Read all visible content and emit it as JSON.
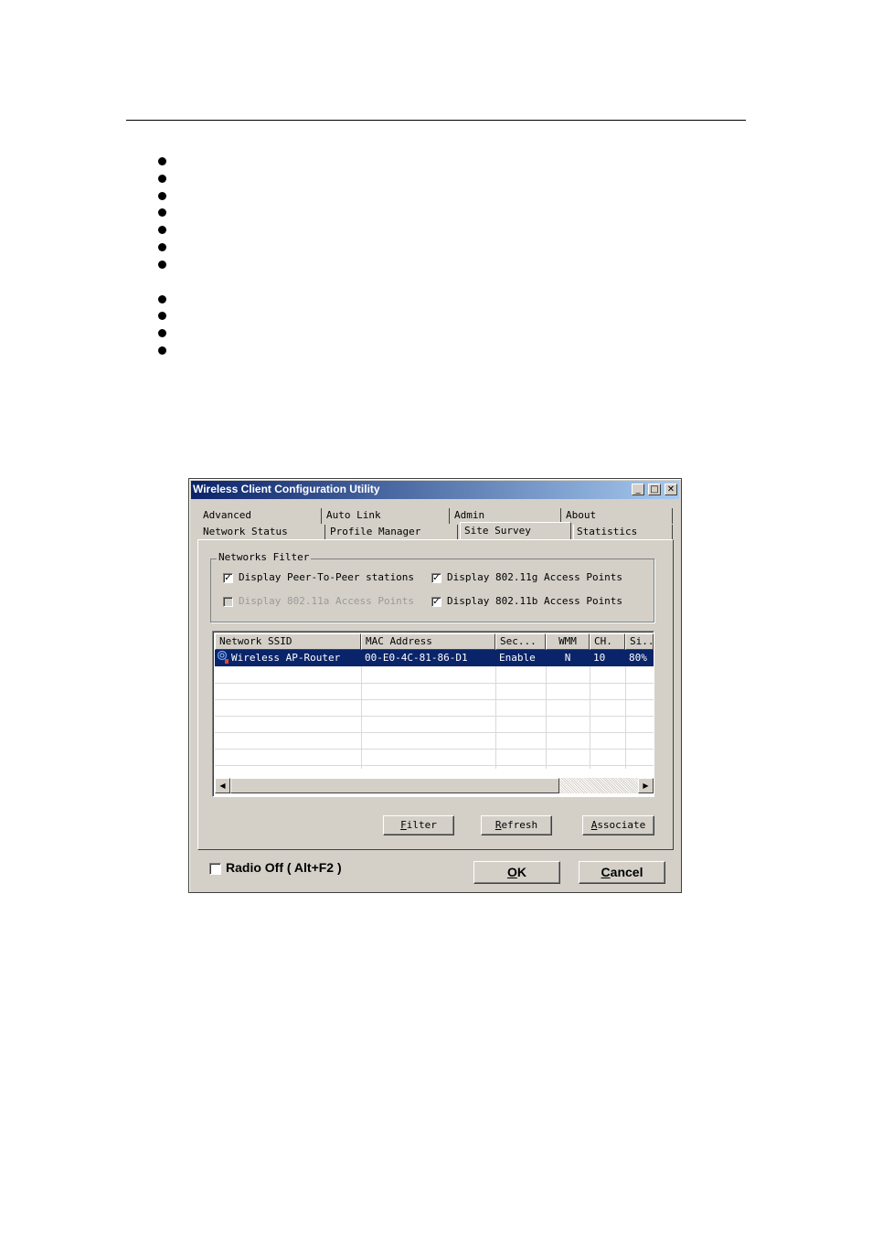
{
  "document": {
    "bullet_count": 11
  },
  "window": {
    "title": "Wireless Client Configuration Utility",
    "minimize_glyph": "_",
    "maximize_glyph": "□",
    "close_glyph": "✕",
    "tabs_row1": [
      "Advanced",
      "Auto Link",
      "Admin",
      "About"
    ],
    "tabs_row2": [
      "Network Status",
      "Profile Manager",
      "Site Survey",
      "Statistics"
    ],
    "active_tab": "Site Survey"
  },
  "filter": {
    "group_label": "Networks Filter",
    "peer_to_peer": {
      "label": "Display Peer-To-Peer stations",
      "checked": true
    },
    "ap_11g": {
      "label": "Display 802.11g Access Points",
      "checked": true
    },
    "ap_11a": {
      "label": "Display 802.11a Access Points",
      "checked": false,
      "disabled": true
    },
    "ap_11b": {
      "label": "Display 802.11b Access Points",
      "checked": true
    }
  },
  "table": {
    "columns": [
      "Network SSID",
      "MAC Address",
      "Sec...",
      "WMM",
      "CH.",
      "Si..."
    ],
    "rows": [
      {
        "ssid": "Wireless AP-Router",
        "mac": "00-E0-4C-81-86-D1",
        "sec": "Enable",
        "wmm": "N",
        "ch": "10",
        "signal": "80%",
        "icon": "wireless-ap-icon",
        "selected": true
      }
    ]
  },
  "buttons": {
    "filter": {
      "mnemonic": "F",
      "rest": "ilter"
    },
    "refresh": {
      "mnemonic": "R",
      "rest": "efresh"
    },
    "associate": {
      "mnemonic": "A",
      "rest": "ssociate"
    },
    "ok": {
      "mnemonic": "O",
      "rest": "K"
    },
    "cancel": {
      "mnemonic": "C",
      "rest": "ancel"
    }
  },
  "radio_off": {
    "label": "Radio Off ( Alt+F2 )",
    "checked": false
  },
  "colors": {
    "selection": "#0a246a",
    "title_start": "#0a246a",
    "title_end": "#a6caf0",
    "face": "#d4d0c8"
  }
}
